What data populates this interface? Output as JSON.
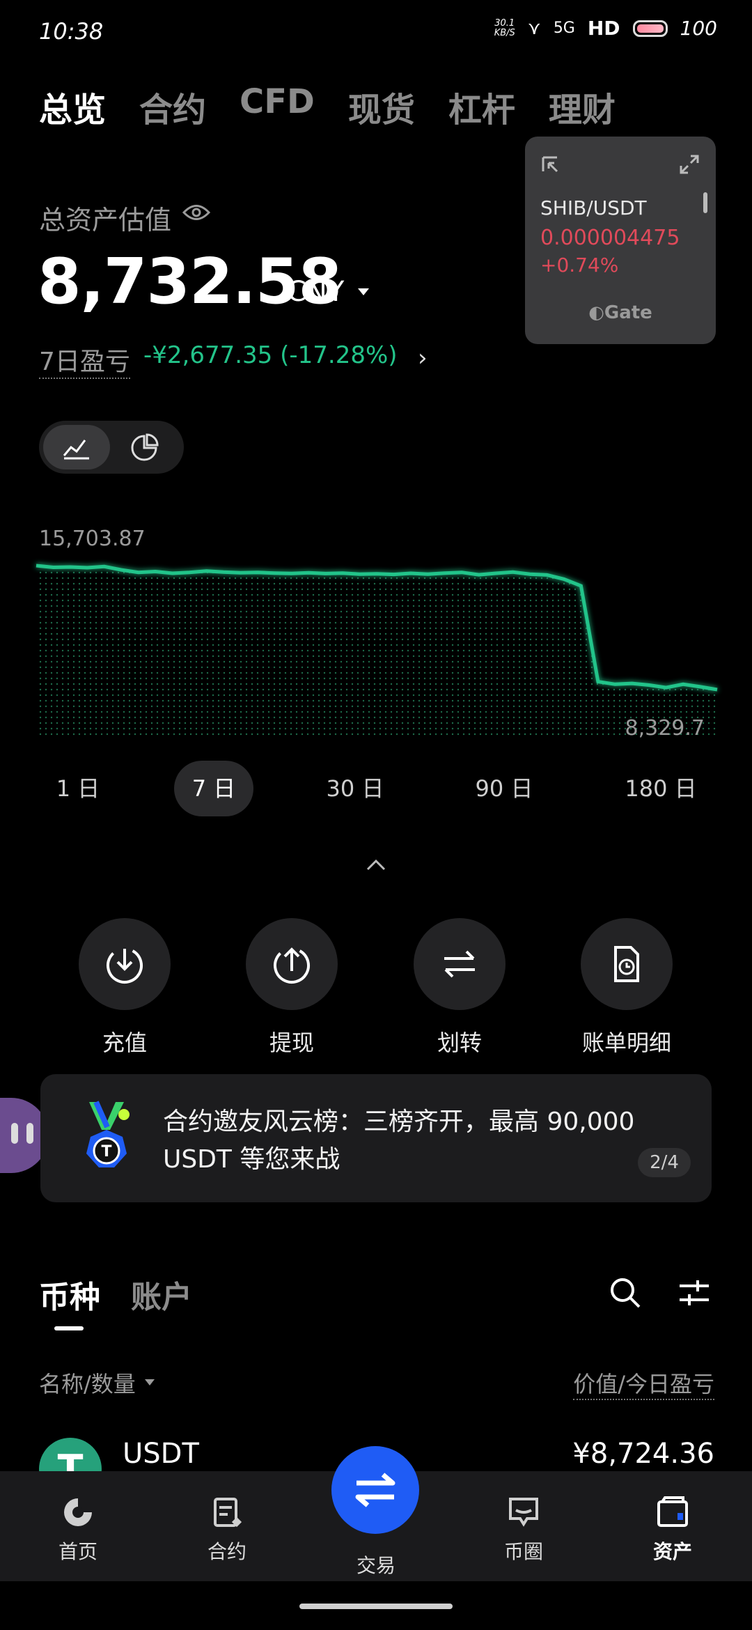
{
  "status_bar": {
    "time": "10:38",
    "net_speed_top": "30.1",
    "net_speed_unit": "KB/S",
    "net_type": "5G",
    "hd": "HD",
    "battery": "100"
  },
  "top_tabs": [
    {
      "label": "总览",
      "active": true
    },
    {
      "label": "合约",
      "active": false
    },
    {
      "label": "CFD",
      "active": false
    },
    {
      "label": "现货",
      "active": false
    },
    {
      "label": "杠杆",
      "active": false
    },
    {
      "label": "理财",
      "active": false
    }
  ],
  "widget": {
    "pair": "SHIB/USDT",
    "price": "0.000004475",
    "change": "+0.74%",
    "brand": "Gate"
  },
  "overview": {
    "total_label": "总资产估值",
    "balance": "8,732.58",
    "currency": "CNY",
    "pnl_label": "7日盈亏",
    "pnl_value": "-¥2,677.35 (-17.28%)"
  },
  "chart_data": {
    "type": "area",
    "max_label": "15,703.87",
    "min_label": "8,329.7",
    "x": [
      0,
      1,
      2,
      3,
      4,
      5,
      6,
      7,
      8,
      9,
      10,
      11,
      12,
      13,
      14,
      15,
      16,
      17,
      18,
      19,
      20,
      21,
      22,
      23,
      24,
      25,
      26,
      27,
      28,
      29,
      30,
      31,
      32,
      33,
      34,
      35,
      36,
      37,
      38,
      39,
      40
    ],
    "values": [
      15703.87,
      15600,
      15620,
      15580,
      15650,
      15450,
      15300,
      15350,
      15250,
      15300,
      15380,
      15320,
      15280,
      15300,
      15260,
      15240,
      15280,
      15230,
      15260,
      15200,
      15220,
      15180,
      15250,
      15200,
      15260,
      15300,
      15160,
      15250,
      15320,
      15200,
      15150,
      14900,
      14500,
      8800,
      8650,
      8700,
      8600,
      8450,
      8650,
      8500,
      8329.7
    ],
    "color": "#23c48a"
  },
  "periods": [
    {
      "label": "1 日",
      "active": false
    },
    {
      "label": "7 日",
      "active": true
    },
    {
      "label": "30 日",
      "active": false
    },
    {
      "label": "90 日",
      "active": false
    },
    {
      "label": "180 日",
      "active": false
    }
  ],
  "actions": [
    {
      "label": "充值",
      "icon": "deposit-icon"
    },
    {
      "label": "提现",
      "icon": "withdraw-icon"
    },
    {
      "label": "划转",
      "icon": "transfer-icon"
    },
    {
      "label": "账单明细",
      "icon": "bill-icon"
    }
  ],
  "banner": {
    "text": "合约邀友风云榜：三榜齐开，最高 90,000 USDT 等您来战",
    "page": "2/4"
  },
  "asset_tabs": [
    {
      "label": "币种",
      "active": true
    },
    {
      "label": "账户",
      "active": false
    }
  ],
  "list_header": {
    "left": "名称/数量",
    "right": "价值/今日盈亏"
  },
  "coins": [
    {
      "symbol": "USDT",
      "icon_letter": "T",
      "value": "¥8,724.36"
    }
  ],
  "bottom_nav": [
    {
      "label": "首页",
      "icon": "home-icon",
      "active": false
    },
    {
      "label": "合约",
      "icon": "contract-icon",
      "active": false
    },
    {
      "label": "交易",
      "icon": "trade-icon",
      "active": false
    },
    {
      "label": "币圈",
      "icon": "community-icon",
      "active": false
    },
    {
      "label": "资产",
      "icon": "wallet-icon",
      "active": true
    }
  ],
  "colors": {
    "positive": "#23c48a",
    "negative": "#e04a5a",
    "accent": "#1f5cf5"
  }
}
